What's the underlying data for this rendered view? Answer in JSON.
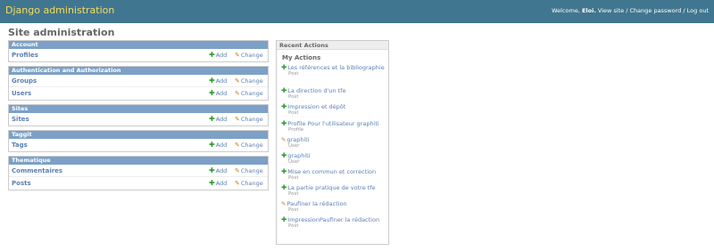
{
  "header": {
    "brand": "Django administration",
    "welcome": "Welcome,",
    "user": "Eloi.",
    "view_site": "View site",
    "change_password": "Change password",
    "logout": "Log out",
    "sep": "/"
  },
  "page_title": "Site administration",
  "modules": [
    {
      "caption": "Account",
      "rows": [
        {
          "name": "Profiles"
        }
      ]
    },
    {
      "caption": "Authentication and Authorization",
      "rows": [
        {
          "name": "Groups"
        },
        {
          "name": "Users"
        }
      ]
    },
    {
      "caption": "Sites",
      "rows": [
        {
          "name": "Sites"
        }
      ]
    },
    {
      "caption": "Taggit",
      "rows": [
        {
          "name": "Tags"
        }
      ]
    },
    {
      "caption": "Thematique",
      "rows": [
        {
          "name": "Commentaires"
        },
        {
          "name": "Posts"
        }
      ]
    }
  ],
  "add_label": "Add",
  "change_label": "Change",
  "icons": {
    "add": "plus-icon",
    "change": "pencil-icon"
  },
  "recent": {
    "caption": "Recent Actions",
    "my_actions": "My Actions",
    "items": [
      {
        "icon": "add",
        "title": "Les références et la bibliographie",
        "type": "Post"
      },
      {
        "icon": "add",
        "title": "La direction d'un tfe",
        "type": "Post"
      },
      {
        "icon": "add",
        "title": "Impression et dépôt",
        "type": "Post"
      },
      {
        "icon": "add",
        "title": "Profile Pour l'utilisateur graphiti",
        "type": "Profile"
      },
      {
        "icon": "change",
        "title": "graphiti",
        "type": "User"
      },
      {
        "icon": "add",
        "title": "graphiti",
        "type": "User"
      },
      {
        "icon": "add",
        "title": "Mise en commun et correction",
        "type": "Post"
      },
      {
        "icon": "add",
        "title": "La partie pratique de votre tfe",
        "type": "Post"
      },
      {
        "icon": "change",
        "title": "Paufiner la rédaction",
        "type": "Post"
      },
      {
        "icon": "add",
        "title": "ImpressionPaufiner la rédaction",
        "type": "Post"
      }
    ]
  },
  "colors": {
    "header_bg": "#417690",
    "brand": "#f5dd5d",
    "caption_bg": "#7ca0c7",
    "link": "#5b80b2",
    "add": "#2a9d2a",
    "change": "#c97a1a"
  }
}
